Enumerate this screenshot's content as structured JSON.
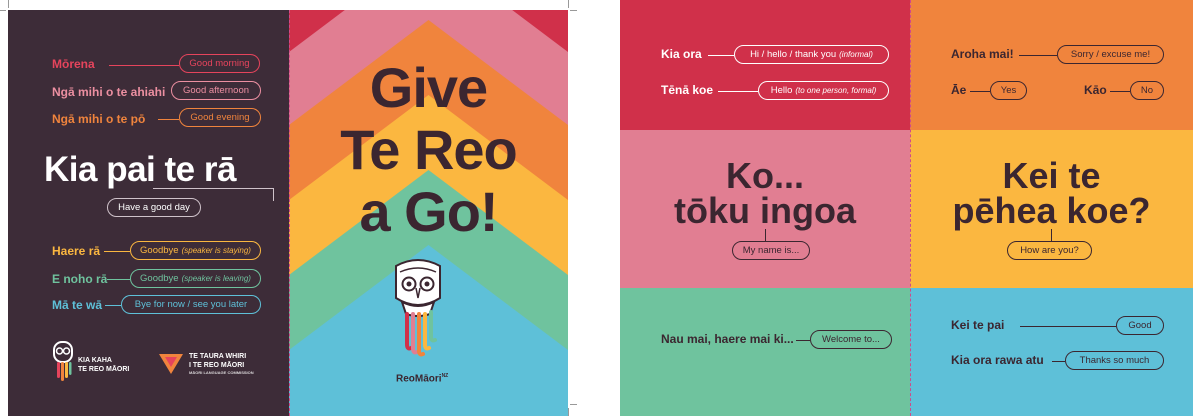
{
  "colors": {
    "dark_panel": "#3d2c38",
    "red": "#d0304a",
    "pink": "#e17e92",
    "orange": "#f0843d",
    "yellow": "#fbb740",
    "teal": "#6fc39e",
    "blue": "#5ec0d8",
    "text_dark": "#3b2630"
  },
  "left_panel": {
    "greetings": [
      {
        "maori": "Mōrena",
        "english": "Good morning",
        "note": ""
      },
      {
        "maori": "Ngā mihi o te ahiahi",
        "english": "Good afternoon",
        "note": ""
      },
      {
        "maori": "Ngā mihi o te pō",
        "english": "Good evening",
        "note": ""
      }
    ],
    "headline": "Kia pai te rā",
    "headline_translation": "Have a good day",
    "farewells": [
      {
        "maori": "Haere rā",
        "english": "Goodbye",
        "note": "(speaker is staying)"
      },
      {
        "maori": "E noho rā",
        "english": "Goodbye",
        "note": "(speaker is leaving)"
      },
      {
        "maori": "Mā te wā",
        "english": "Bye for now / see you later",
        "note": ""
      }
    ],
    "logo1_line1": "KIA KAHA",
    "logo1_line2": "TE REO MĀORI",
    "logo2_line1": "TE TAURA WHIRI",
    "logo2_line2": "I TE REO MĀORI",
    "logo2_line3": "MĀORI LANGUAGE COMMISSION"
  },
  "center_panel": {
    "title_line1": "Give",
    "title_line2": "Te Reo",
    "title_line3": "a Go!",
    "brand": "ReoMāori",
    "brand_sup": "NZ"
  },
  "right_spread": {
    "top_left": [
      {
        "maori": "Kia ora",
        "english": "Hi / hello / thank you",
        "note": "(informal)"
      },
      {
        "maori": "Tēnā koe",
        "english": "Hello",
        "note": "(to one person, formal)"
      }
    ],
    "top_right": [
      {
        "maori": "Aroha mai!",
        "english": "Sorry / excuse me!"
      },
      {
        "maori": "Āe",
        "english": "Yes"
      },
      {
        "maori": "Kāo",
        "english": "No"
      }
    ],
    "mid_left_line1": "Ko...",
    "mid_left_line2": "tōku ingoa",
    "mid_left_translation": "My name is...",
    "mid_right_line1": "Kei te",
    "mid_right_line2": "pēhea koe?",
    "mid_right_translation": "How are you?",
    "bottom_left": {
      "maori": "Nau mai, haere mai ki...",
      "english": "Welcome to..."
    },
    "bottom_right": [
      {
        "maori": "Kei te pai",
        "english": "Good"
      },
      {
        "maori": "Kia ora rawa atu",
        "english": "Thanks so much"
      }
    ]
  }
}
